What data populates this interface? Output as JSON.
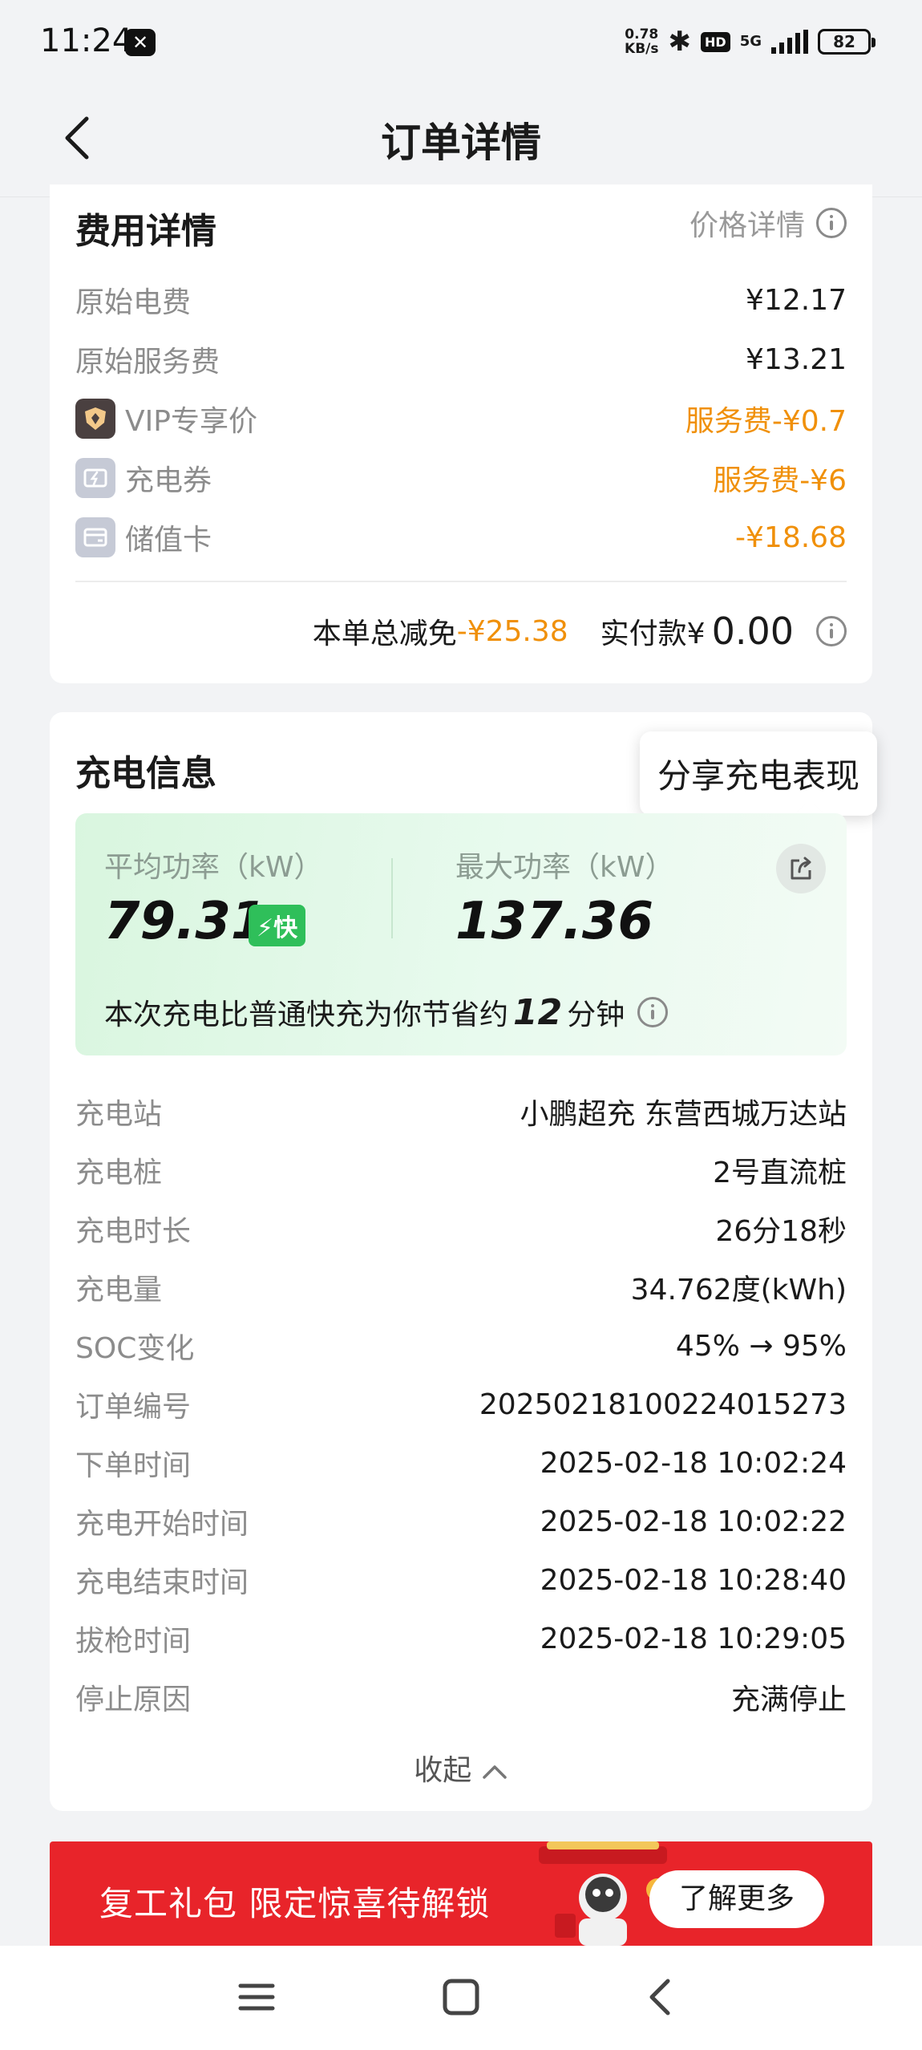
{
  "status_bar": {
    "time": "11:24",
    "app_icon": "x-app-icon",
    "net_speed_value": "0.78",
    "net_speed_unit": "KB/s",
    "hd": "HD",
    "network": "5G",
    "battery": "82"
  },
  "header": {
    "title": "订单详情"
  },
  "fee": {
    "title": "费用详情",
    "price_detail_label": "价格详情",
    "rows": [
      {
        "label": "原始电费",
        "value": "¥12.17"
      },
      {
        "label": "原始服务费",
        "value": "¥13.21"
      },
      {
        "label": "VIP专享价",
        "value": "服务费-¥0.7"
      },
      {
        "label": "充电券",
        "value": "服务费-¥6"
      },
      {
        "label": "储值卡",
        "value": "-¥18.68"
      }
    ],
    "total_discount_label": "本单总减免",
    "total_discount_value": "-¥25.38",
    "paid_label": "实付款¥",
    "paid_value": "0.00"
  },
  "charge": {
    "title": "充电信息",
    "share_tooltip": "分享充电表现",
    "avg_power_label": "平均功率（kW）",
    "avg_power_value": "79.31",
    "fast_badge": "⚡快",
    "max_power_label": "最大功率（kW）",
    "max_power_value": "137.36",
    "saving_prefix": "本次充电比普通快充为你节省约",
    "saving_minutes": "12",
    "saving_suffix": "分钟",
    "rows": [
      {
        "label": "充电站",
        "value": "小鹏超充 东营西城万达站"
      },
      {
        "label": "充电桩",
        "value": "2号直流桩"
      },
      {
        "label": "充电时长",
        "value": "26分18秒"
      },
      {
        "label": "充电量",
        "value": "34.762度(kWh)"
      },
      {
        "label": "SOC变化",
        "value": "45% → 95%"
      },
      {
        "label": "订单编号",
        "value": "20250218100224015273"
      },
      {
        "label": "下单时间",
        "value": "2025-02-18 10:02:24"
      },
      {
        "label": "充电开始时间",
        "value": "2025-02-18 10:02:22"
      },
      {
        "label": "充电结束时间",
        "value": "2025-02-18 10:28:40"
      },
      {
        "label": "拔枪时间",
        "value": "2025-02-18 10:29:05"
      },
      {
        "label": "停止原因",
        "value": "充满停止"
      }
    ],
    "collapse_label": "收起"
  },
  "banner": {
    "text": "复工礼包 限定惊喜待解锁",
    "button": "了解更多"
  },
  "colors": {
    "accent_orange": "#f0900a",
    "fast_green": "#2fbf5a",
    "banner_red": "#e8242a"
  }
}
